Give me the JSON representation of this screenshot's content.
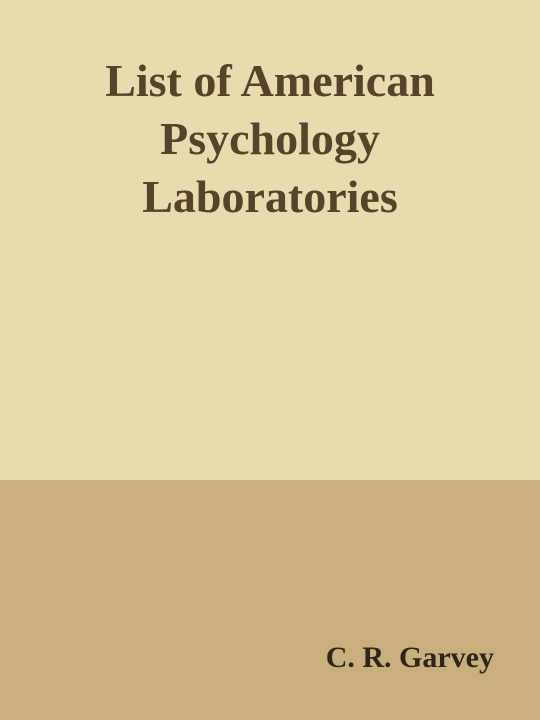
{
  "cover": {
    "title_lines": [
      "List of American",
      "Psychology",
      "Laboratories"
    ],
    "author": "C. R. Garvey",
    "colors": {
      "top_background": "#e8dbad",
      "bottom_background": "#c8b07e",
      "title_text": "#55432a",
      "author_text": "#2f2618"
    }
  }
}
